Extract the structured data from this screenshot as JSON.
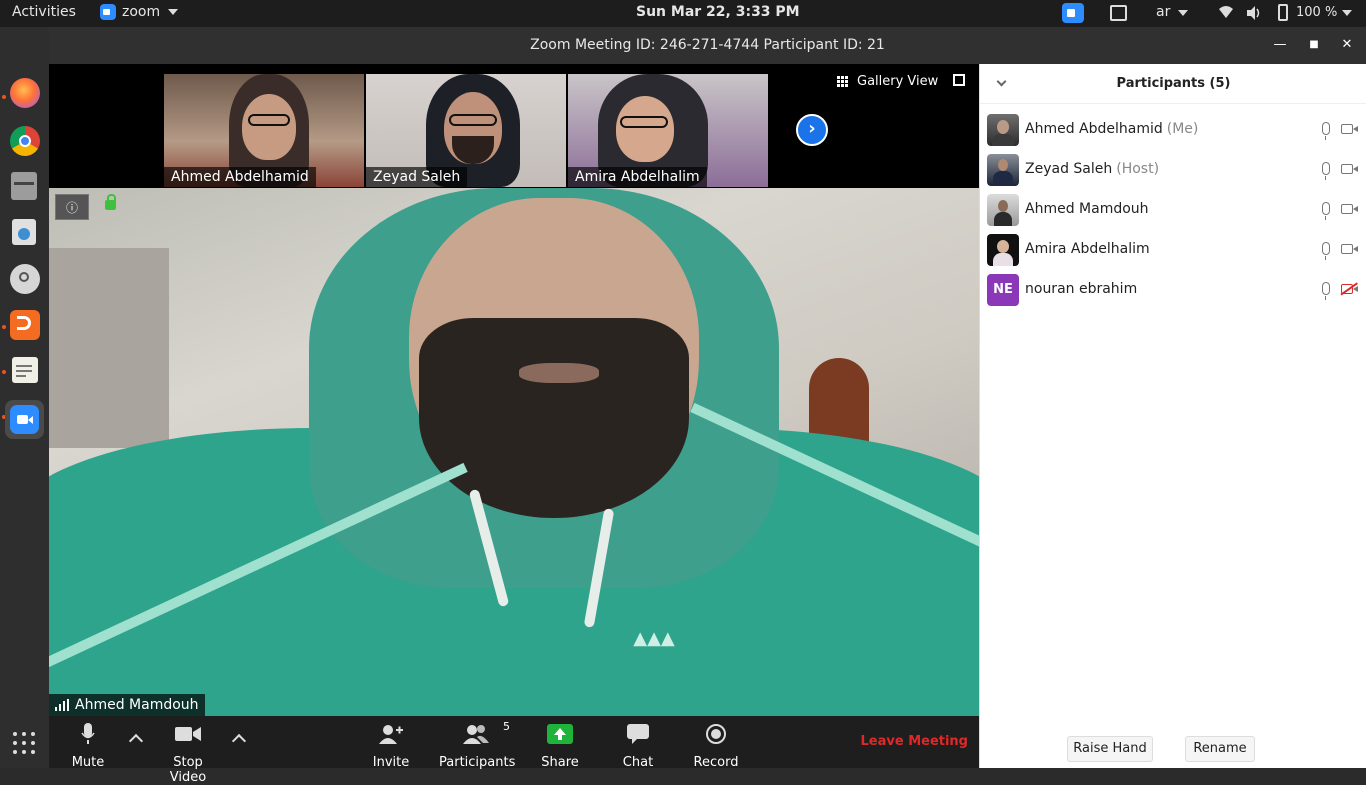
{
  "topbar": {
    "activities": "Activities",
    "app_name": "zoom",
    "clock": "Sun Mar 22,  3:33 PM",
    "lang": "ar",
    "battery": "100 %"
  },
  "window": {
    "title": "Zoom Meeting ID: 246-271-4744 Participant ID: 21"
  },
  "video": {
    "gallery_view": "Gallery View",
    "thumbnails": [
      {
        "name": "Ahmed Abdelhamid"
      },
      {
        "name": "Zeyad Saleh"
      },
      {
        "name": "Amira Abdelhalim"
      }
    ],
    "active_speaker": "Ahmed Mamdouh"
  },
  "toolbar": {
    "mute": "Mute",
    "stop_video": "Stop Video",
    "invite": "Invite",
    "participants": "Participants",
    "participants_count": "5",
    "share": "Share",
    "chat": "Chat",
    "record": "Record",
    "leave": "Leave Meeting"
  },
  "panel": {
    "title": "Participants (5)",
    "participants": [
      {
        "name": "Ahmed Abdelhamid",
        "role": "(Me)"
      },
      {
        "name": "Zeyad Saleh",
        "role": "(Host)"
      },
      {
        "name": "Ahmed Mamdouh",
        "role": ""
      },
      {
        "name": "Amira Abdelhalim",
        "role": ""
      },
      {
        "name": "nouran ebrahim",
        "role": "",
        "initials": "NE"
      }
    ],
    "raise_hand": "Raise Hand",
    "rename": "Rename"
  },
  "colors": {
    "zoom_blue": "#2d8cff",
    "leave_red": "#e02828",
    "share_green": "#1fb33b",
    "initials_purple": "#8a38b8"
  }
}
